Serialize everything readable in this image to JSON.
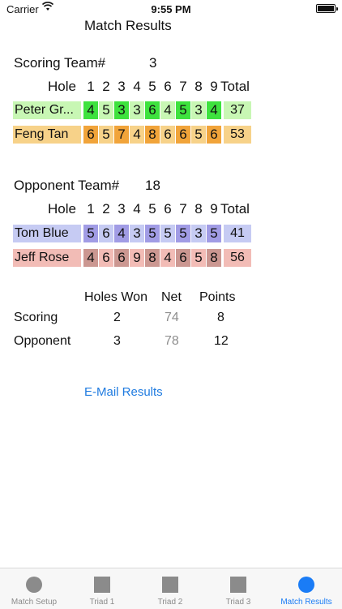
{
  "status_bar": {
    "carrier": "Carrier",
    "time": "9:55 PM"
  },
  "screen_title": "Match Results",
  "colors": {
    "green_light": "#c8f7b4",
    "green_dark": "#3ee23e",
    "orange_light": "#f7d289",
    "orange_dark": "#f1a43a",
    "blue_light": "#c6cbf3",
    "blue_dark": "#a19ce5",
    "red_light": "#f2bcb6",
    "red_dark": "#cb9791",
    "accent": "#1a7cf6",
    "link": "#1f7be0"
  },
  "scoring_team": {
    "label": "Scoring Team#",
    "number": "3",
    "header": {
      "hole_label": "Hole",
      "holes": [
        "1",
        "2",
        "3",
        "4",
        "5",
        "6",
        "7",
        "8",
        "9"
      ],
      "total_label": "Total"
    },
    "players": [
      {
        "name": "Peter Gr...",
        "scores": [
          "4",
          "5",
          "3",
          "3",
          "6",
          "4",
          "5",
          "3",
          "4"
        ],
        "total": "37"
      },
      {
        "name": "Feng Tan",
        "scores": [
          "6",
          "5",
          "7",
          "4",
          "8",
          "6",
          "6",
          "5",
          "6"
        ],
        "total": "53"
      }
    ]
  },
  "opponent_team": {
    "label": "Opponent Team#",
    "number": "18",
    "header": {
      "hole_label": "Hole",
      "holes": [
        "1",
        "2",
        "3",
        "4",
        "5",
        "6",
        "7",
        "8",
        "9"
      ],
      "total_label": "Total"
    },
    "players": [
      {
        "name": "Tom Blue",
        "scores": [
          "5",
          "6",
          "4",
          "3",
          "5",
          "5",
          "5",
          "3",
          "5"
        ],
        "total": "41"
      },
      {
        "name": "Jeff Rose",
        "scores": [
          "4",
          "6",
          "6",
          "9",
          "8",
          "4",
          "6",
          "5",
          "8"
        ],
        "total": "56"
      }
    ]
  },
  "summary": {
    "headers": {
      "holes_won": "Holes Won",
      "net": "Net",
      "points": "Points"
    },
    "rows": [
      {
        "label": "Scoring",
        "holes_won": "2",
        "net": "74",
        "points": "8"
      },
      {
        "label": "Opponent",
        "holes_won": "3",
        "net": "78",
        "points": "12"
      }
    ]
  },
  "email_label": "E-Mail Results",
  "tabs": [
    {
      "label": "Match Setup",
      "icon": "circle-icon"
    },
    {
      "label": "Triad 1",
      "icon": "square-icon"
    },
    {
      "label": "Triad 2",
      "icon": "square-icon"
    },
    {
      "label": "Triad 3",
      "icon": "square-icon"
    },
    {
      "label": "Match Results",
      "icon": "circle-icon",
      "active": true
    }
  ]
}
